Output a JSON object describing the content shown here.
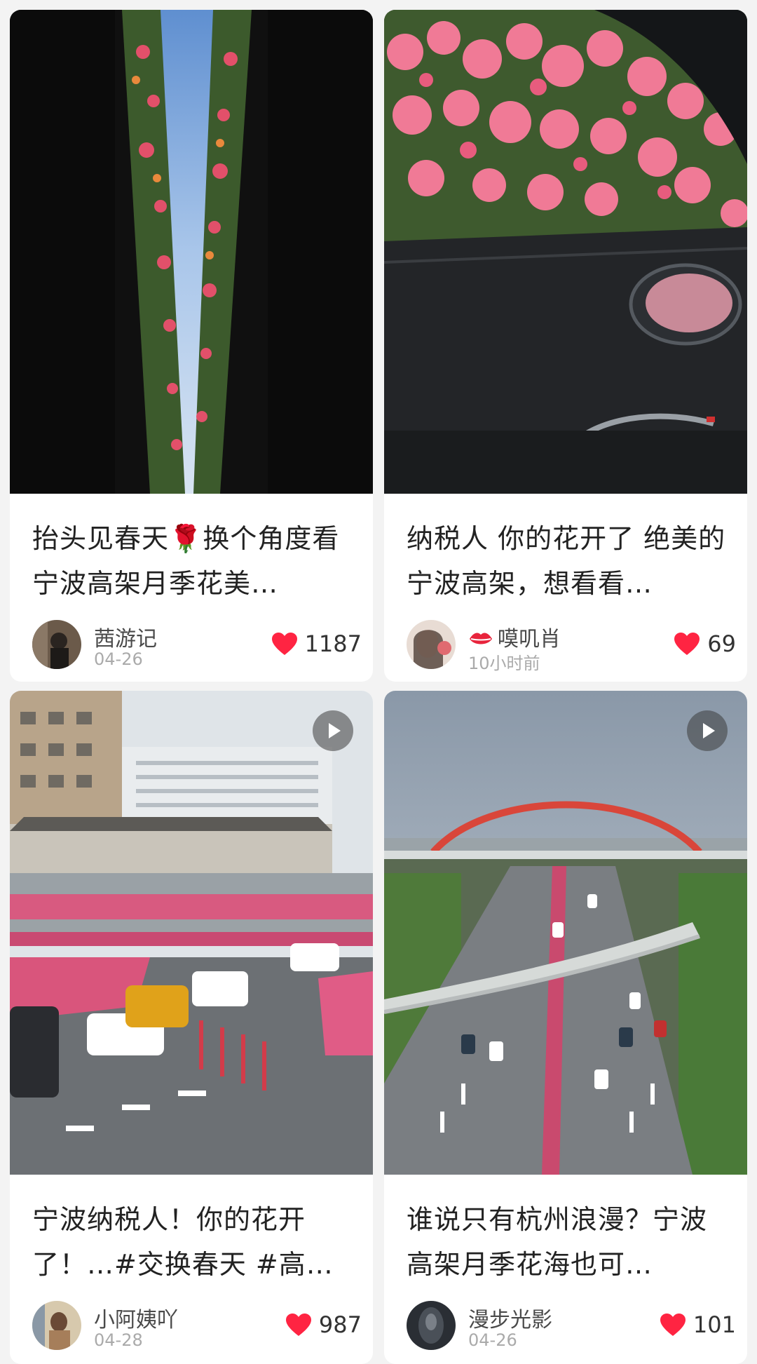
{
  "feed": {
    "posts": [
      {
        "title": "抬头见春天🌹换个角度看宁波高架月季花美…",
        "author": "茜游记",
        "date": "04-26",
        "likes": "1187",
        "video": false
      },
      {
        "title": "纳税人 你的花开了 绝美的宁波高架，想看看…",
        "author": "嗼叽肖",
        "date": "10小时前",
        "likes": "69",
        "video": false
      },
      {
        "title": "宁波纳税人！你的花开了！…#交换春天 #高…",
        "author": "小阿姨吖",
        "date": "04-28",
        "likes": "987",
        "video": true
      },
      {
        "title": "谁说只有杭州浪漫？宁波高架月季花海也可…",
        "author": "漫步光影",
        "date": "04-26",
        "likes": "101",
        "video": true
      }
    ]
  },
  "icons": {
    "like": "heart-icon",
    "video": "play-icon",
    "author_badge": "lips-icon"
  },
  "colors": {
    "heart": "#ff2442",
    "lips": "#e8243c"
  }
}
